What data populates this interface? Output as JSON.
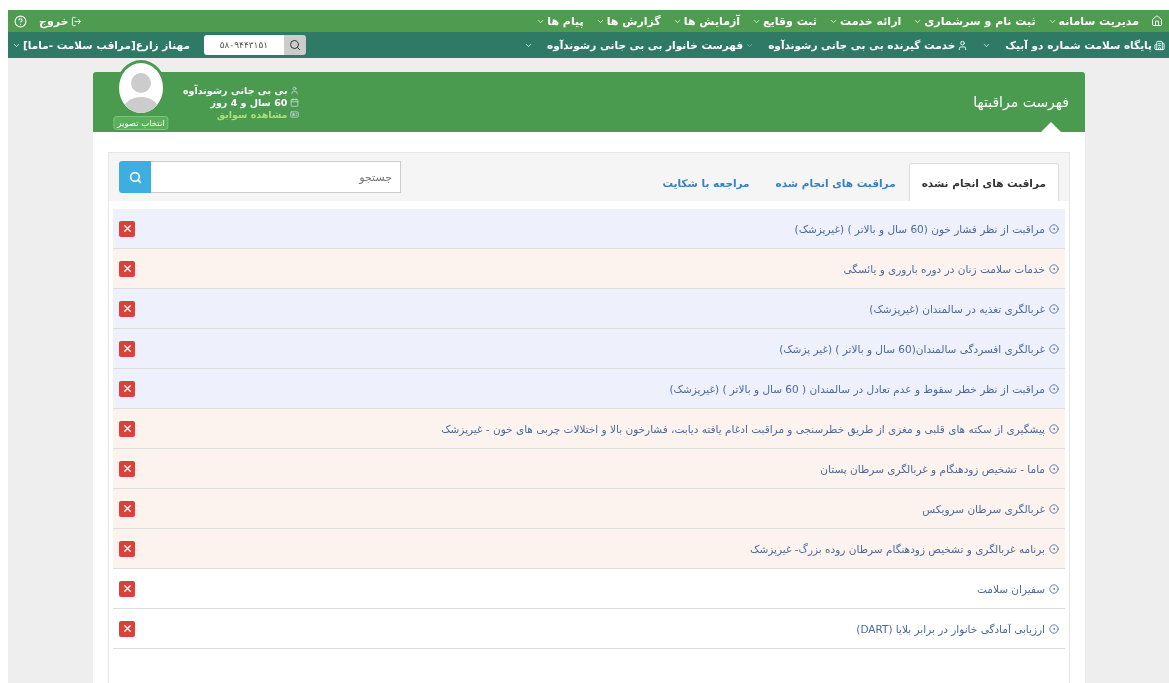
{
  "top_menu": [
    {
      "label": "مدیریت سامانه"
    },
    {
      "label": "ثبت نام و سرشماری"
    },
    {
      "label": "ارائه خدمت"
    },
    {
      "label": "ثبت وقایع"
    },
    {
      "label": "آزمایش ها"
    },
    {
      "label": "گزارش ها"
    },
    {
      "label": "پیام ها"
    }
  ],
  "logout": "خروج",
  "context_bar": [
    {
      "kind": "facility",
      "label": "پایگاه سلامت شماره دو آبیک"
    },
    {
      "kind": "client",
      "label": "خدمت گیرنده بی بی جانی رشوندآوه"
    },
    {
      "kind": "household",
      "label": "فهرست خانوار بی بی جانی رشوندآوه"
    }
  ],
  "national_id_search": {
    "value": "۵۸۰۹۴۴۳۱۵۱"
  },
  "current_user": "مهناز زارع[مراقب سلامت -ماما]",
  "panel": {
    "title": "فهرست مراقبتها",
    "client": {
      "name": "بی بی جانی رشوندآوه",
      "age": "60 سال و 4 روز",
      "history_link": "مشاهده سوابق",
      "photo_button": "انتخاب تصویر"
    }
  },
  "tabs": [
    {
      "label": "مراقبت های انجام نشده",
      "selected": true
    },
    {
      "label": "مراقبت های انجام شده",
      "selected": false
    },
    {
      "label": "مراجعه با شکایت",
      "selected": false
    }
  ],
  "search": {
    "placeholder": "جستجو"
  },
  "care_items": [
    {
      "label": "مراقبت از نظر فشار خون (60 سال و بالاتر ) (غیرپزشک)",
      "color": "#eef0fb"
    },
    {
      "label": "خدمات سلامت زنان در دوره باروری و یائسگی",
      "color": "#fdf3ee"
    },
    {
      "label": "غربالگری تغذیه در سالمندان (غیرپزشک)",
      "color": "#eef0fb"
    },
    {
      "label": "غربالگری افسردگی سالمندان(60 سال و بالاتر ) (غیر پزشک)",
      "color": "#eef0fb"
    },
    {
      "label": "مراقبت از نظر خطر سقوط و عدم تعادل در سالمندان ( 60 سال و بالاتر ) (غیرپزشک)",
      "color": "#eef0fb"
    },
    {
      "label": "پیشگیری از سکته های قلبی و مغزی از طریق خطرسنجی و مراقبت ادغام یافته دیابت، فشارخون بالا و اختلالات چربی های خون - غیرپزشک",
      "color": "#fdf3ee"
    },
    {
      "label": "ماما - تشخیص زودهنگام و غربالگری سرطان پستان",
      "color": "#fdf3ee"
    },
    {
      "label": "غربالگری سرطان سرویکس",
      "color": "#fdf3ee"
    },
    {
      "label": "برنامه غربالگری و تشخیص زودهنگام سرطان روده بزرگ- غیرپزشک",
      "color": "#fdf3ee"
    },
    {
      "label": "سفیران سلامت",
      "color": "#ffffff"
    },
    {
      "label": "ارزیابی آمادگی خانوار در برابر بلایا (DART)",
      "color": "#ffffff"
    }
  ]
}
